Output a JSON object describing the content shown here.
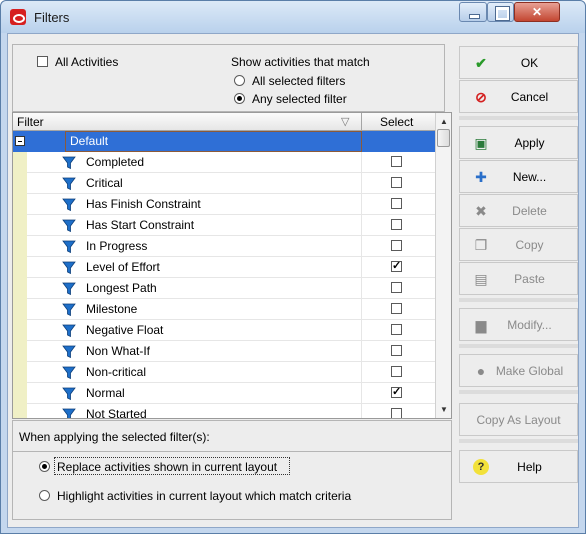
{
  "window": {
    "title": "Filters"
  },
  "options": {
    "all_activities_label": "All Activities",
    "all_activities_checked": false,
    "match_heading": "Show activities that match",
    "match_all": "All selected filters",
    "match_any": "Any selected filter",
    "match_selected": "any"
  },
  "grid": {
    "col_filter": "Filter",
    "col_select": "Select",
    "group": "Default",
    "rows": [
      {
        "name": "Completed",
        "selected": false
      },
      {
        "name": "Critical",
        "selected": false
      },
      {
        "name": "Has Finish Constraint",
        "selected": false
      },
      {
        "name": "Has Start Constraint",
        "selected": false
      },
      {
        "name": "In Progress",
        "selected": false
      },
      {
        "name": "Level of Effort",
        "selected": true
      },
      {
        "name": "Longest Path",
        "selected": false
      },
      {
        "name": "Milestone",
        "selected": false
      },
      {
        "name": "Negative Float",
        "selected": false
      },
      {
        "name": "Non What-If",
        "selected": false
      },
      {
        "name": "Non-critical",
        "selected": false
      },
      {
        "name": "Normal",
        "selected": true
      },
      {
        "name": "Not Started",
        "selected": false
      }
    ]
  },
  "apply_section": {
    "heading": "When applying the selected filter(s):",
    "replace": "Replace activities shown in current layout",
    "highlight": "Highlight activities in current layout which match criteria",
    "selected": "replace"
  },
  "buttons": {
    "ok": "OK",
    "cancel": "Cancel",
    "apply": "Apply",
    "new": "New...",
    "delete": "Delete",
    "copy": "Copy",
    "paste": "Paste",
    "modify": "Modify...",
    "make_global": "Make Global",
    "copy_as_layout": "Copy As Layout",
    "help": "Help"
  },
  "colors": {
    "group_row": "#2f6fd6",
    "filter_icon": "#1e6fc9",
    "gutter": "#f0f0c6",
    "close_button": "#c34631"
  }
}
